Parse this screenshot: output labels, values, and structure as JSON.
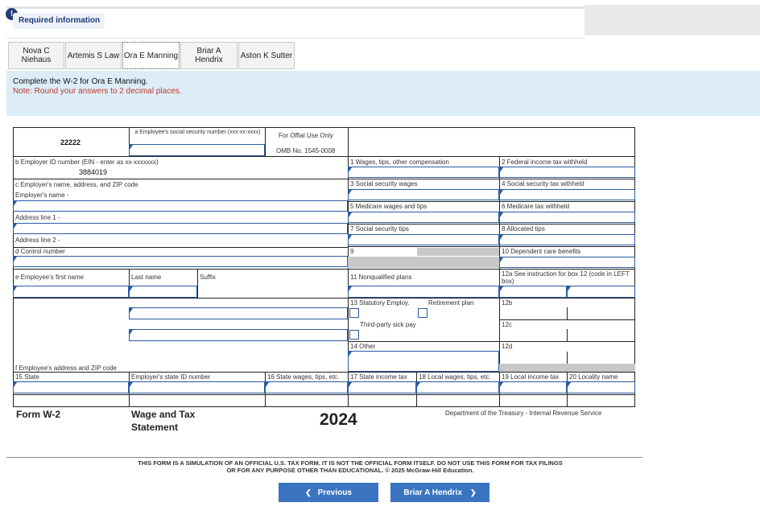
{
  "header": {
    "required_label": "Required information",
    "alert_glyph": "!"
  },
  "tabs": [
    {
      "label": "Nova C\nNiehaus"
    },
    {
      "label": "Artemis S Law"
    },
    {
      "label": "Ora E Manning"
    },
    {
      "label": "Briar A\nHendrix"
    },
    {
      "label": "Aston K Sutter"
    }
  ],
  "instructions": {
    "text": "Complete the W-2 for Ora E Manning.",
    "note": "Note: Round your answers to 2 decimal places."
  },
  "form": {
    "control_code": "22222",
    "box_a_label": "a  Employee's social security number (xxx-xx-xxxx)",
    "official_use": "For Offial Use Only",
    "omb": "OMB No. 1545-0008",
    "box_b_label": "b  Employer ID number (EIN - enter as xx-xxxxxxx)",
    "box_b_value": "3884019",
    "box_c_label": "c  Employer's name, address, and ZIP code",
    "employer_name_label": "Employer's name -",
    "address1_label": "Address line 1 -",
    "address2_label": "Address line 2 -",
    "box_d_label": "d  Control number",
    "box_e_label": "e  Employee's first name",
    "last_name_label": "Last name",
    "suffix_label": "Suffix",
    "box_f_label": "f  Employee's address and ZIP code",
    "box1": "1  Wages, tips, other compensation",
    "box2": "2  Federal income tax withheld",
    "box3": "3  Social security wages",
    "box4": "4  Social security tax withheld",
    "box5": "5  Medicare wages and tips",
    "box6": "6  Medicare tax withheld",
    "box7": "7  Social security tips",
    "box8": "8  Allocated tips",
    "box9": "9",
    "box10": "10 Dependent care benefits",
    "box11": "11 Nonqualified plans",
    "box12a": "12a See instruction for box 12 (code in LEFT box)",
    "box13": "13 Statutory Employ.",
    "retirement": "Retirement plan",
    "third_party": "Third-party sick pay",
    "box12b": "12b",
    "box12c": "12c",
    "box12d": "12d",
    "box14": "14 Other",
    "box15": "15 State",
    "employer_state_id": "Employer's state ID number",
    "box16": "16 State wages, tips, etc.",
    "box17": "17 State income tax",
    "box18": "18 Local wages, tips, etc.",
    "box19": "19 Local income tax",
    "box20": "20 Locality name",
    "form_name": "Form W-2",
    "form_title": "Wage and Tax Statement",
    "year": "2024",
    "department": "Department of the Treasury - Internal Revenue Service"
  },
  "disclaimer": "THIS FORM IS A SIMULATION OF AN OFFICIAL U.S. TAX FORM. IT IS NOT THE OFFICIAL FORM ITSELF. DO NOT USE THIS FORM FOR TAX FILINGS OR FOR ANY PURPOSE OTHER THAN EDUCATIONAL. © 2025 McGraw-Hill Education.",
  "nav": {
    "prev_label": "Previous",
    "next_label": "Briar A Hendrix",
    "prev_glyph": "❮",
    "next_glyph": "❯"
  },
  "colors": {
    "accent": "#3a74c0",
    "instruction_bg": "#dcedf8",
    "note": "#c0392b"
  }
}
